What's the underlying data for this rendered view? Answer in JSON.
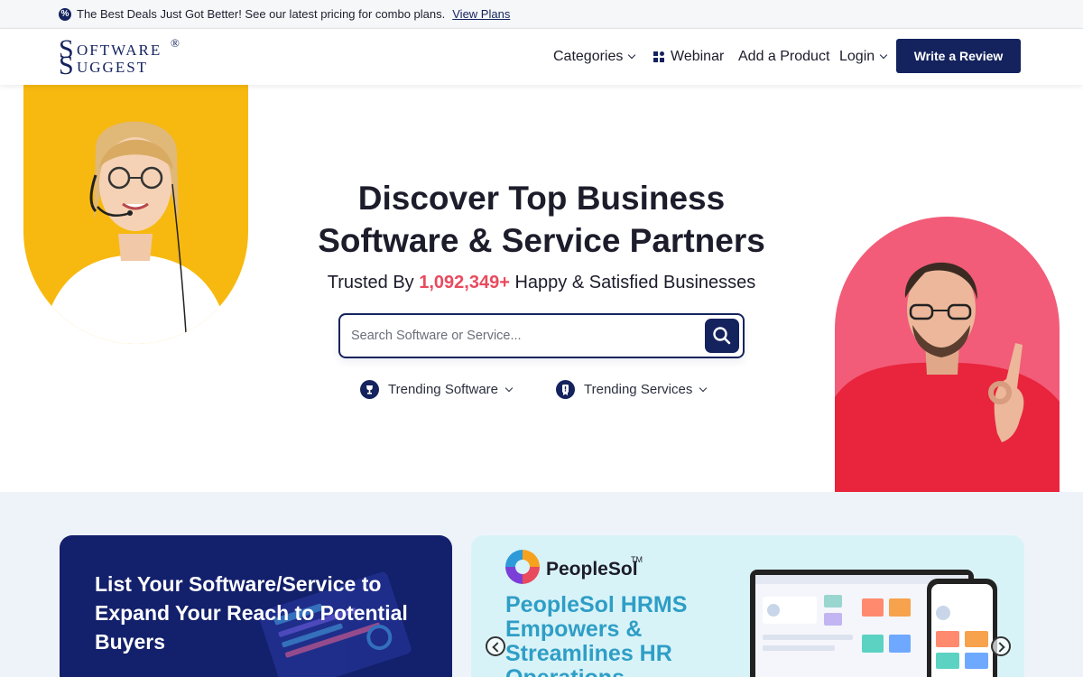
{
  "announcement": {
    "text": "The Best Deals Just Got Better! See our latest pricing for combo plans.",
    "link": "View Plans"
  },
  "logo": {
    "part1_big": "S",
    "part1_rest": "OFTWARE",
    "part2_big": "S",
    "part2_rest": "UGGEST",
    "reg": "®"
  },
  "nav": {
    "categories": "Categories",
    "webinar": "Webinar",
    "add_product": "Add a Product",
    "login": "Login",
    "write_review": "Write a Review"
  },
  "hero": {
    "title_line1": "Discover Top Business",
    "title_line2": "Software & Service Partners",
    "sub_prefix": "Trusted By",
    "sub_count": "1,092,349+",
    "sub_suffix": "Happy & Satisfied Businesses",
    "search_placeholder": "Search Software or Service...",
    "trending_software": "Trending Software",
    "trending_services": "Trending Services"
  },
  "cards": {
    "list_text": "List Your Software/Service to Expand Your Reach to Potential Buyers",
    "promo_brand": "PeopleSol",
    "promo_tm": "TM",
    "promo_headline": "PeopleSol HRMS Empowers & Streamlines HR Operations"
  },
  "colors": {
    "brand_navy": "#14235e",
    "accent_red": "#e94a5e",
    "hero_yellow": "#f7b90f",
    "hero_pink": "#f25c78"
  }
}
